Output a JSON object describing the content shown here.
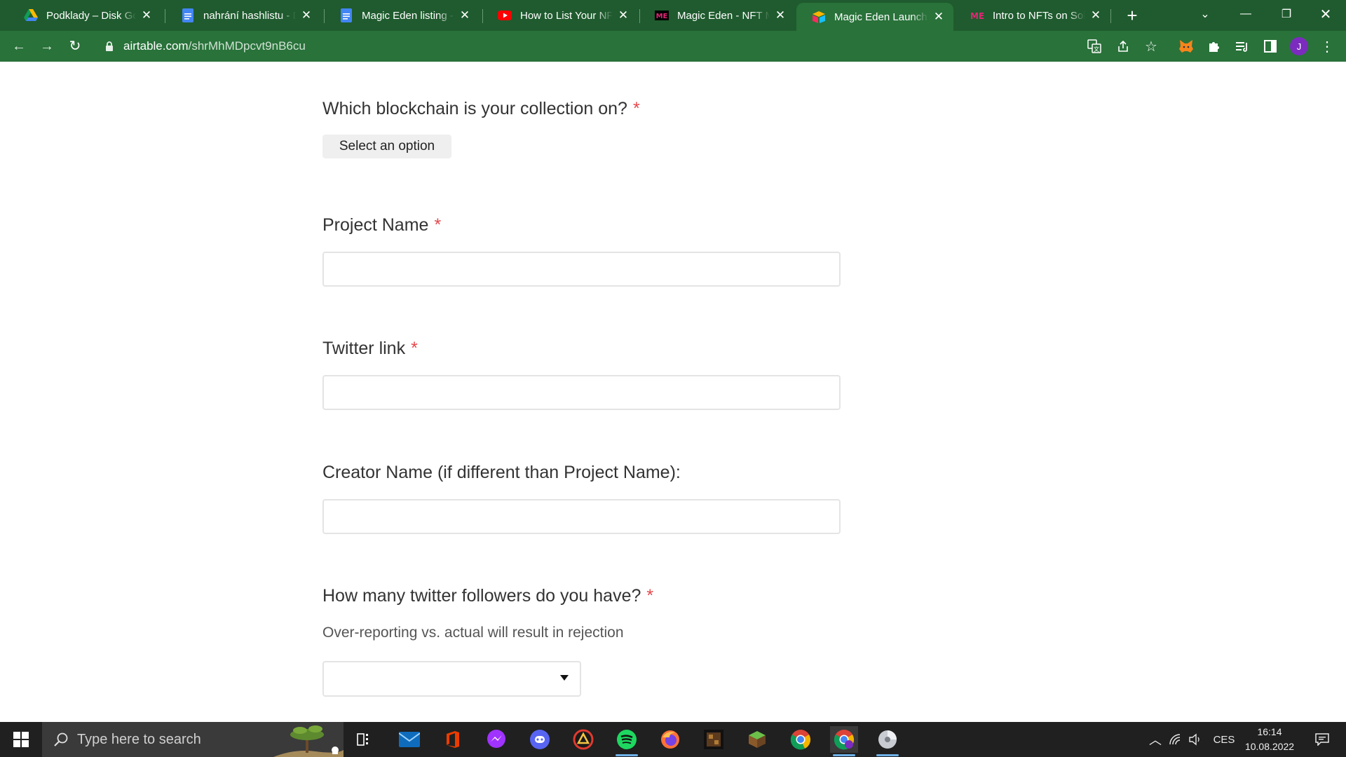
{
  "browser": {
    "tabs": [
      {
        "title": "Podklady – Disk Google",
        "icon": "google-drive-icon",
        "active": false
      },
      {
        "title": "nahrání hashlistu - Dokumenty Google",
        "icon": "google-docs-icon",
        "active": false
      },
      {
        "title": "Magic Eden listing - Dokumenty Google",
        "icon": "google-docs-icon",
        "active": false
      },
      {
        "title": "How to List Your NFT - YouTube",
        "icon": "youtube-icon",
        "active": false
      },
      {
        "title": "Magic Eden - NFT Marketplace",
        "icon": "magic-eden-icon",
        "active": false
      },
      {
        "title": "Magic Eden Launchpad",
        "icon": "airtable-icon",
        "active": true
      },
      {
        "title": "Intro to NFTs on Solana",
        "icon": "magic-eden-icon",
        "active": false
      }
    ],
    "url_host": "airtable.com",
    "url_path": "/shrMhMDpcvt9nB6cu",
    "profile_initial": "J"
  },
  "form": {
    "blockchain": {
      "label": "Which blockchain is your collection on?",
      "required": "*",
      "button": "Select an option"
    },
    "project_name": {
      "label": "Project Name",
      "required": "*",
      "value": ""
    },
    "twitter_link": {
      "label": "Twitter link",
      "required": "*",
      "value": ""
    },
    "creator_name": {
      "label": "Creator Name (if different than Project Name):",
      "value": ""
    },
    "followers": {
      "label": "How many twitter followers do you have?",
      "required": "*",
      "help": "Over-reporting vs. actual will result in rejection",
      "selected": ""
    }
  },
  "taskbar": {
    "search_placeholder": "Type here to search",
    "language": "CES",
    "time": "16:14",
    "date": "10.08.2022"
  },
  "colors": {
    "tab_strip": "#1f5b2e",
    "toolbar": "#29723a",
    "required": "#e5484d",
    "taskbar": "#202020"
  }
}
